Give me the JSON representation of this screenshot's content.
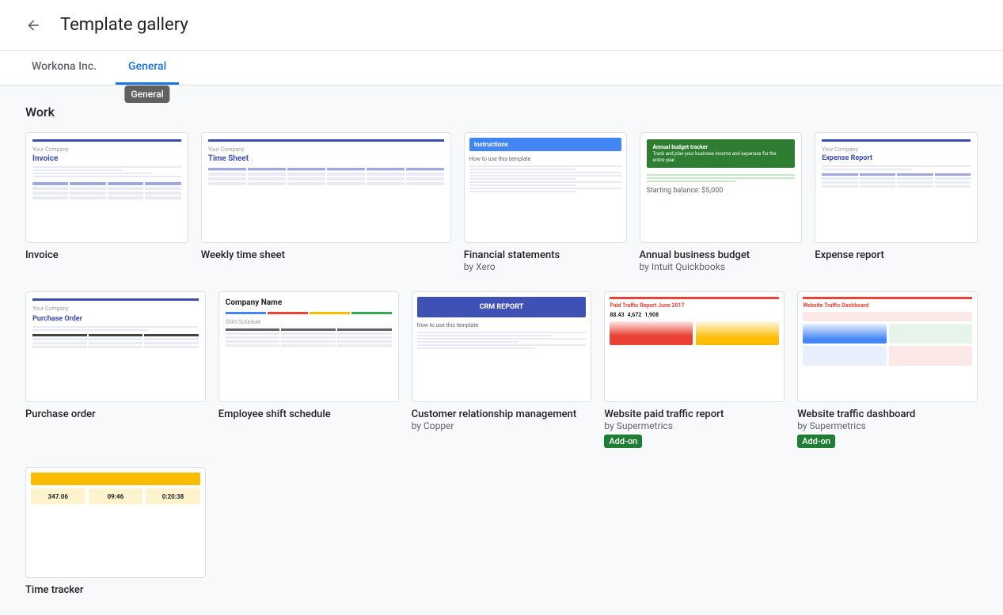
{
  "header": {
    "back_label": "←",
    "title": "Template gallery"
  },
  "tabs": [
    {
      "id": "workona",
      "label": "Workona Inc.",
      "active": false
    },
    {
      "id": "general",
      "label": "General",
      "active": true,
      "tooltip": "General"
    }
  ],
  "section_work": {
    "title": "Work"
  },
  "templates_row1": [
    {
      "id": "invoice",
      "name": "Invoice",
      "by": "",
      "addon": false,
      "thumb_type": "invoice"
    },
    {
      "id": "weekly-time-sheet",
      "name": "Weekly time sheet",
      "by": "",
      "addon": false,
      "thumb_type": "timesheet"
    },
    {
      "id": "financial-statements",
      "name": "Financial statements",
      "by": "by Xero",
      "addon": false,
      "thumb_type": "financial"
    },
    {
      "id": "annual-business-budget",
      "name": "Annual business budget",
      "by": "by Intuit Quickbooks",
      "addon": false,
      "thumb_type": "annual"
    },
    {
      "id": "expense-report",
      "name": "Expense report",
      "by": "",
      "addon": false,
      "thumb_type": "expense"
    }
  ],
  "templates_row2": [
    {
      "id": "purchase-order",
      "name": "Purchase order",
      "by": "",
      "addon": false,
      "thumb_type": "purchase"
    },
    {
      "id": "employee-shift-schedule",
      "name": "Employee shift schedule",
      "by": "",
      "addon": false,
      "thumb_type": "shift"
    },
    {
      "id": "crm",
      "name": "Customer relationship management",
      "by": "by Copper",
      "addon": false,
      "thumb_type": "crm"
    },
    {
      "id": "paid-traffic",
      "name": "Website paid traffic report",
      "by": "by Supermetrics",
      "addon": true,
      "addon_label": "Add-on",
      "thumb_type": "paid-traffic"
    },
    {
      "id": "traffic-dashboard",
      "name": "Website traffic dashboard",
      "by": "by Supermetrics",
      "addon": true,
      "addon_label": "Add-on",
      "thumb_type": "traffic-dash"
    }
  ],
  "templates_row3": [
    {
      "id": "time-tracker",
      "name": "Time tracker",
      "by": "",
      "addon": false,
      "thumb_type": "timetracker",
      "stat1": "347.06",
      "stat2": "09:46",
      "stat3": "0:20:38"
    }
  ]
}
